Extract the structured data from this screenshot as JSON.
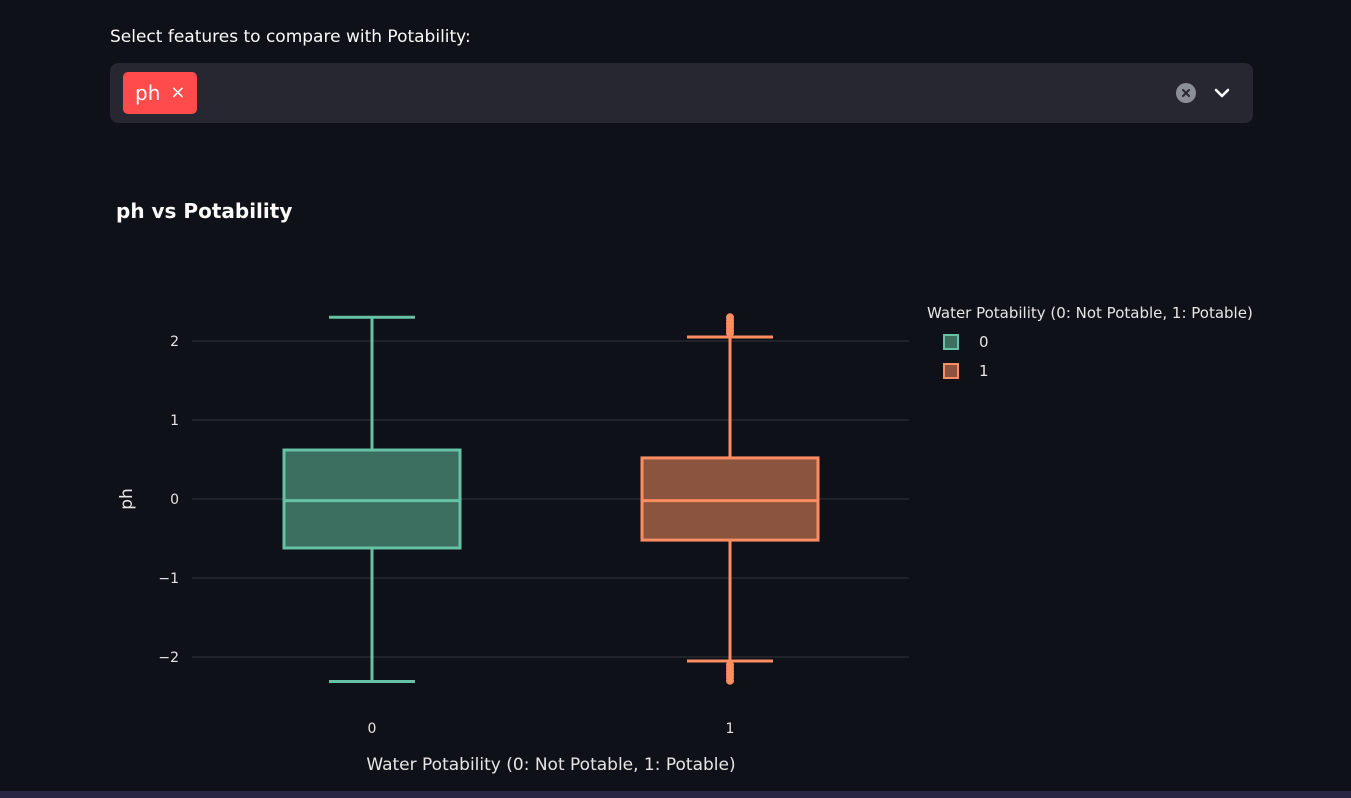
{
  "select": {
    "label": "Select features to compare with Potability:",
    "chips": [
      {
        "label": "ph",
        "remove_symbol": "×"
      }
    ]
  },
  "colors": {
    "accent": "#ff4b4b",
    "series0": "#66c2a5",
    "series0_fill": "#3d6f61",
    "series1": "#fc8d62",
    "series1_fill": "#8b543e",
    "grid": "#31343b",
    "background": "#0e1117"
  },
  "icons": {
    "clear": "clear-circle-icon",
    "dropdown": "chevron-down-icon"
  },
  "chart_data": {
    "type": "box",
    "title": "ph vs Potability",
    "xlabel": "Water Potability (0: Not Potable, 1: Potable)",
    "ylabel": "ph",
    "ylim": [
      -2.55,
      2.6
    ],
    "yticks": [
      2,
      1,
      0,
      -1,
      -2
    ],
    "ytick_labels": [
      "2",
      "1",
      "0",
      "−1",
      "−2"
    ],
    "categories": [
      "0",
      "1"
    ],
    "legend": {
      "title": "Water Potability (0: Not Potable, 1: Potable)",
      "position": "top-right"
    },
    "grid": true,
    "series": [
      {
        "name": "0",
        "min": -2.31,
        "q1": -0.62,
        "median": -0.02,
        "q3": 0.62,
        "max": 2.3,
        "outliers": []
      },
      {
        "name": "1",
        "min": -2.05,
        "q1": -0.52,
        "median": -0.02,
        "q3": 0.52,
        "max": 2.05,
        "outliers": [
          2.1,
          2.14,
          2.18,
          2.22,
          2.26,
          2.3,
          -2.1,
          -2.14,
          -2.18,
          -2.22,
          -2.26,
          -2.3
        ]
      }
    ]
  }
}
